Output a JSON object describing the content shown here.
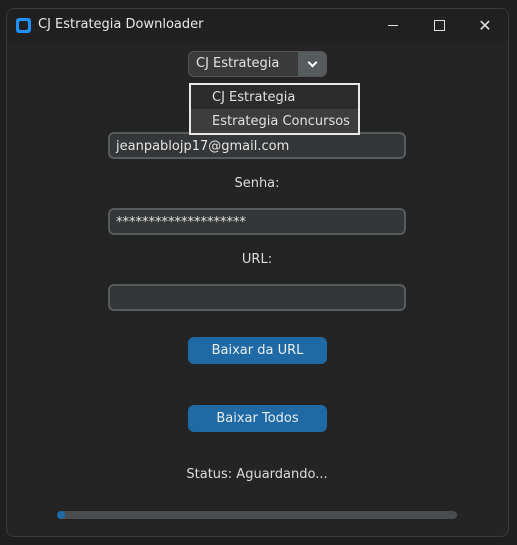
{
  "window": {
    "title": "CJ Estrategia Downloader"
  },
  "platform_select": {
    "value": "CJ Estrategia",
    "options": [
      "CJ Estrategia",
      "Estrategia Concursos"
    ]
  },
  "form": {
    "email_value": "jeanpablojp17@gmail.com",
    "password_label": "Senha:",
    "password_value": "********************",
    "url_label": "URL:",
    "url_value": ""
  },
  "buttons": {
    "download_url": "Baixar da URL",
    "download_all": "Baixar Todos"
  },
  "status": {
    "text": "Status: Aguardando..."
  },
  "progress": {
    "fraction": 0.02
  },
  "colors": {
    "accent": "#1f6aa5",
    "background": "#242424",
    "field": "#343638"
  }
}
